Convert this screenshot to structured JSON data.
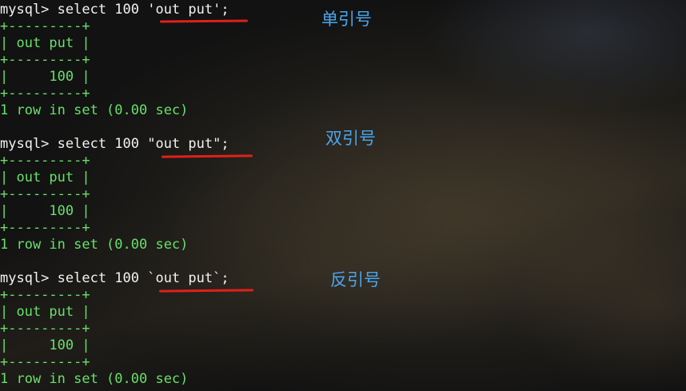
{
  "blocks": [
    {
      "command": "mysql> select 100 'out put';",
      "border": "+---------+",
      "header": "| out put |",
      "value": "|     100 |",
      "footer": "1 row in set (0.00 sec)",
      "caption": "单引号"
    },
    {
      "command": "mysql> select 100 \"out put\";",
      "border": "+---------+",
      "header": "| out put |",
      "value": "|     100 |",
      "footer": "1 row in set (0.00 sec)",
      "caption": "双引号"
    },
    {
      "command": "mysql> select 100 `out put`;",
      "border": "+---------+",
      "header": "| out put |",
      "value": "|     100 |",
      "footer": "1 row in set (0.00 sec)",
      "caption": "反引号"
    }
  ],
  "colors": {
    "terminal_text": "#68e06a",
    "command_text": "#f2f2f2",
    "annotation_underline": "#e0201a",
    "annotation_caption": "#4aa6ee"
  }
}
